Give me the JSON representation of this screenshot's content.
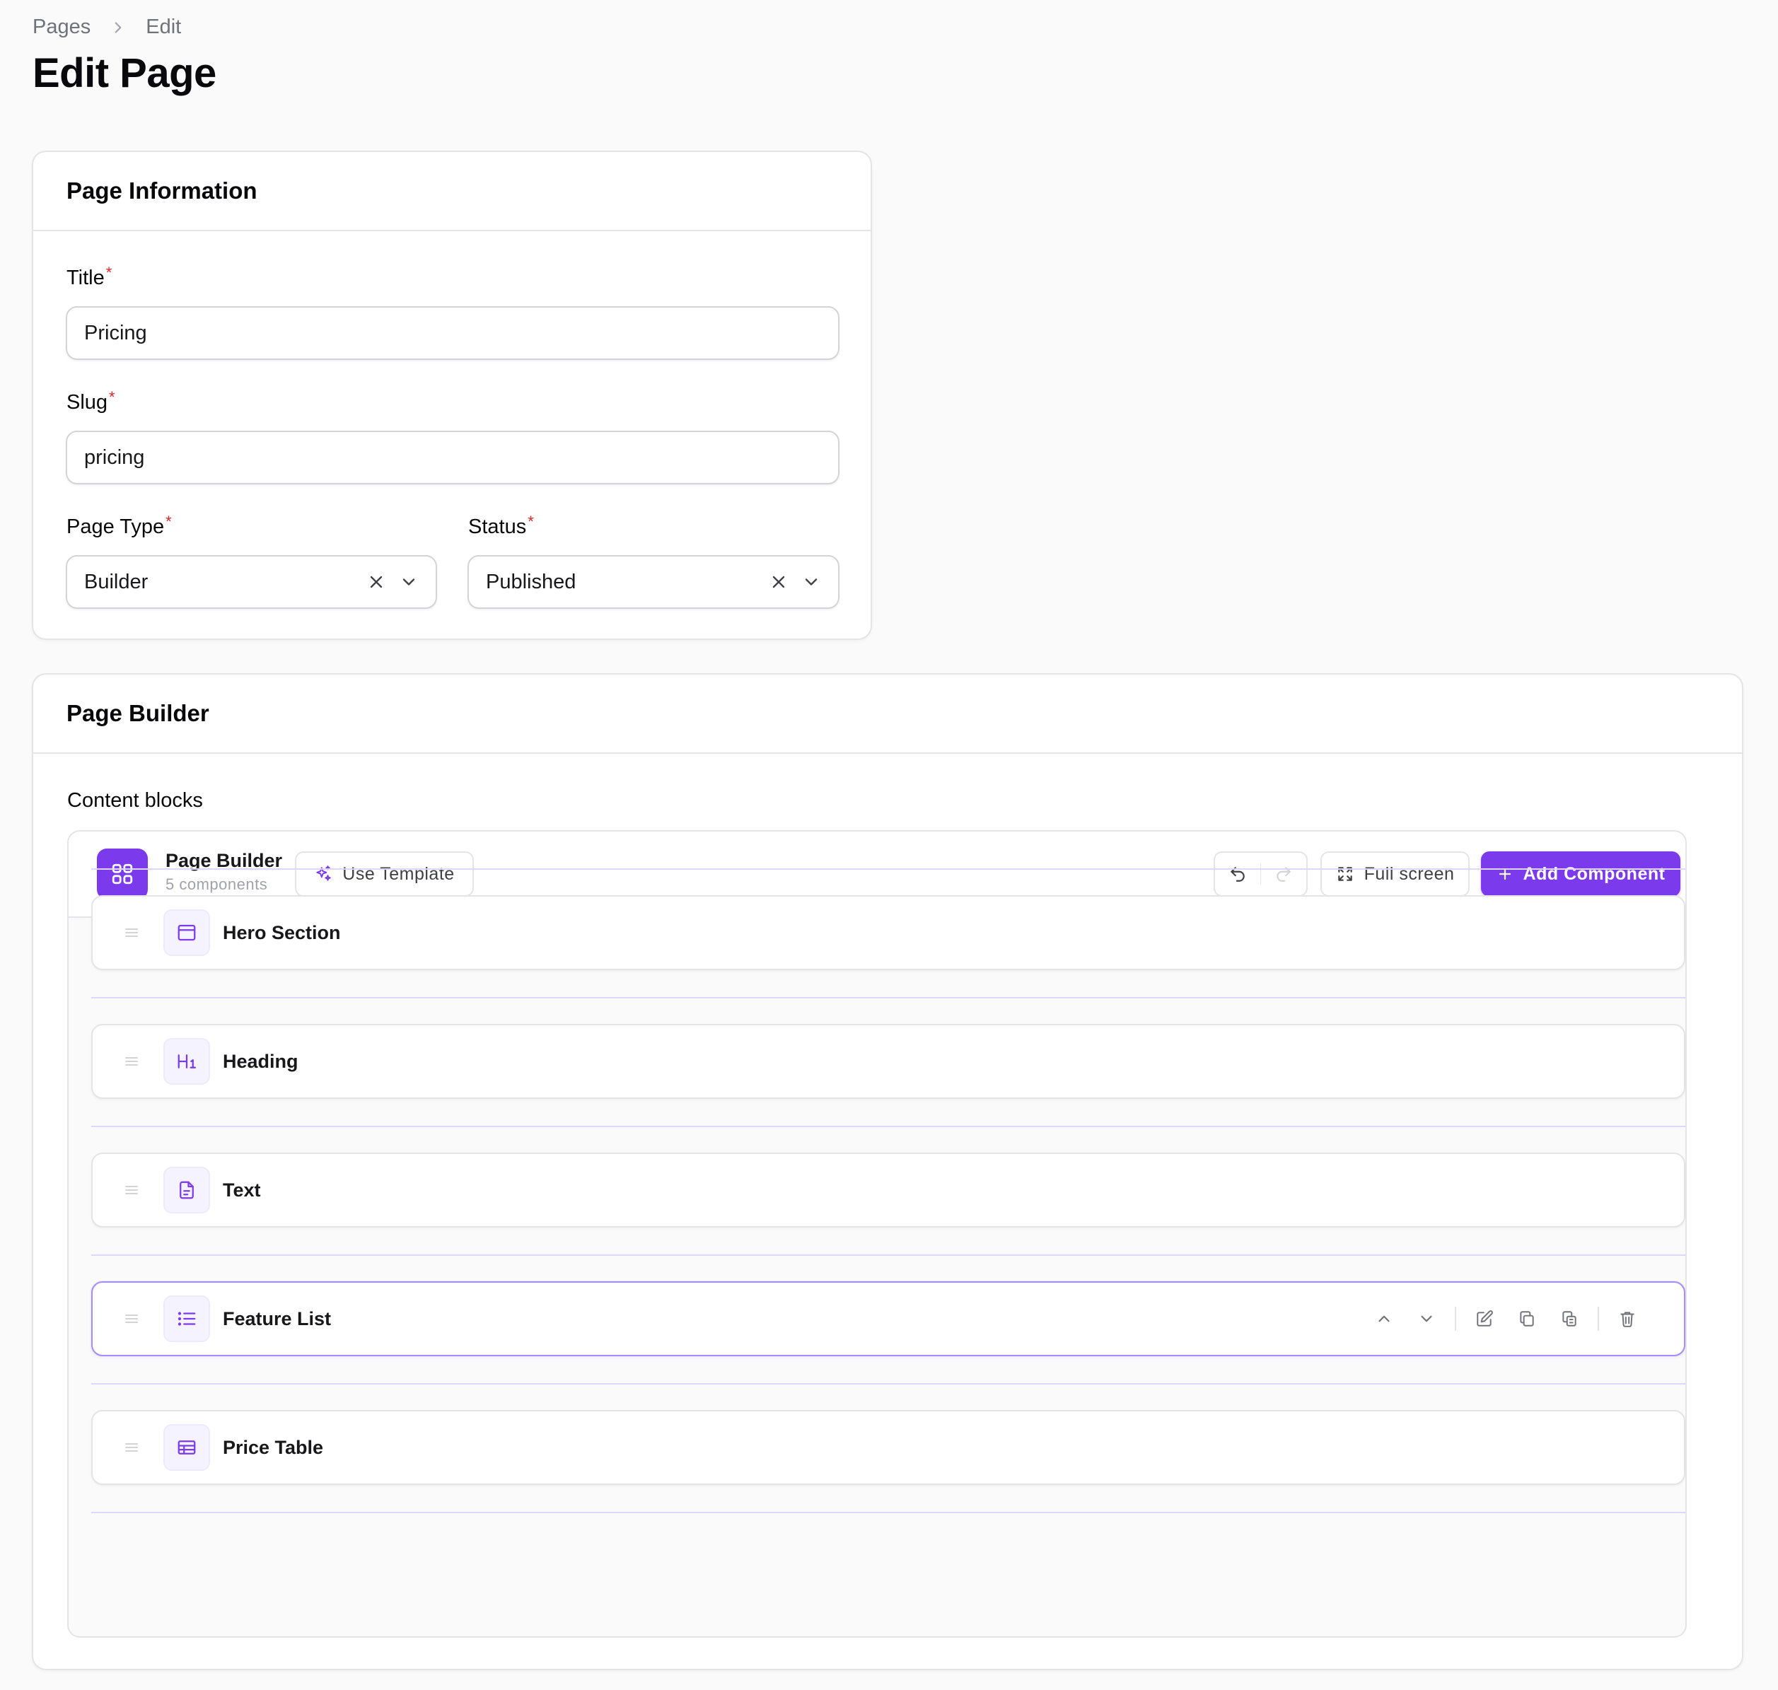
{
  "breadcrumb": {
    "items": [
      "Pages",
      "Edit"
    ]
  },
  "page_title": "Edit Page",
  "info_card": {
    "header": "Page Information",
    "fields": {
      "title": {
        "label": "Title",
        "value": "Pricing",
        "required": "*"
      },
      "slug": {
        "label": "Slug",
        "value": "pricing",
        "required": "*"
      },
      "page_type": {
        "label": "Page Type",
        "value": "Builder",
        "required": "*"
      },
      "status": {
        "label": "Status",
        "value": "Published",
        "required": "*"
      }
    }
  },
  "builder_card": {
    "header": "Page Builder",
    "content_label": "Content blocks",
    "toolbar": {
      "title": "Page Builder",
      "count": "5 components",
      "use_template": "Use Template",
      "full_screen": "Full screen",
      "add_component": "Add Component"
    },
    "blocks": [
      {
        "label": "Hero Section",
        "icon": "layout-icon"
      },
      {
        "label": "Heading",
        "icon": "heading-icon"
      },
      {
        "label": "Text",
        "icon": "file-text-icon"
      },
      {
        "label": "Feature List",
        "icon": "list-icon"
      },
      {
        "label": "Price Table",
        "icon": "table-icon"
      }
    ]
  },
  "colors": {
    "accent": "#7c3aed",
    "required": "#dc2626",
    "border": "#e4e4e7",
    "background": "#fafafa"
  }
}
